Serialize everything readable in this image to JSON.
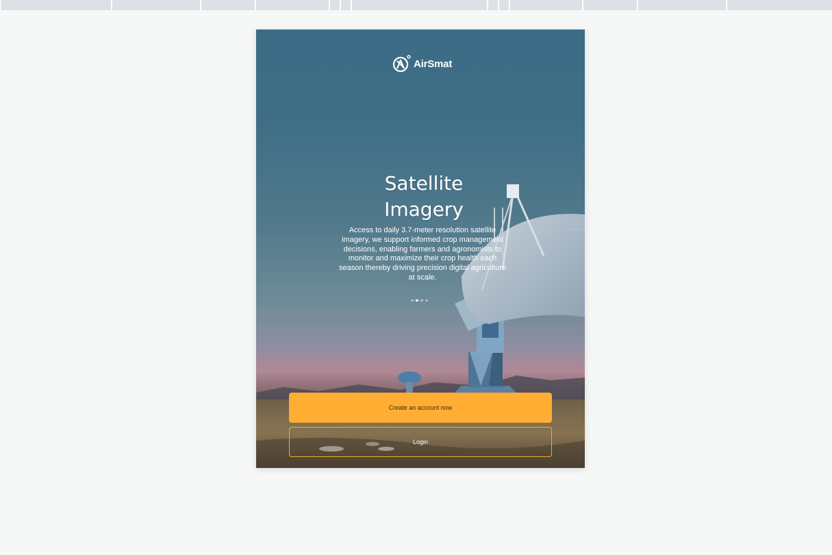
{
  "brand": {
    "name": "AirSmat"
  },
  "onboarding": {
    "title_line1": "Satellite",
    "title_line2": "Imagery",
    "description": "Access to daily 3.7-meter resolution satellite imagery, we support informed crop management decisions, enabling farmers and agronomists to monitor and maximize their crop health each season thereby driving precision digital agriculture at scale.",
    "pager": {
      "total": 4,
      "active_index": 1
    }
  },
  "actions": {
    "create_account_label": "Create an account now",
    "login_label": "Login"
  },
  "colors": {
    "primary": "#ffae33",
    "login_border": "#f0b030",
    "sky_top": "#3c6c86",
    "page_background": "#f6f7f7"
  }
}
